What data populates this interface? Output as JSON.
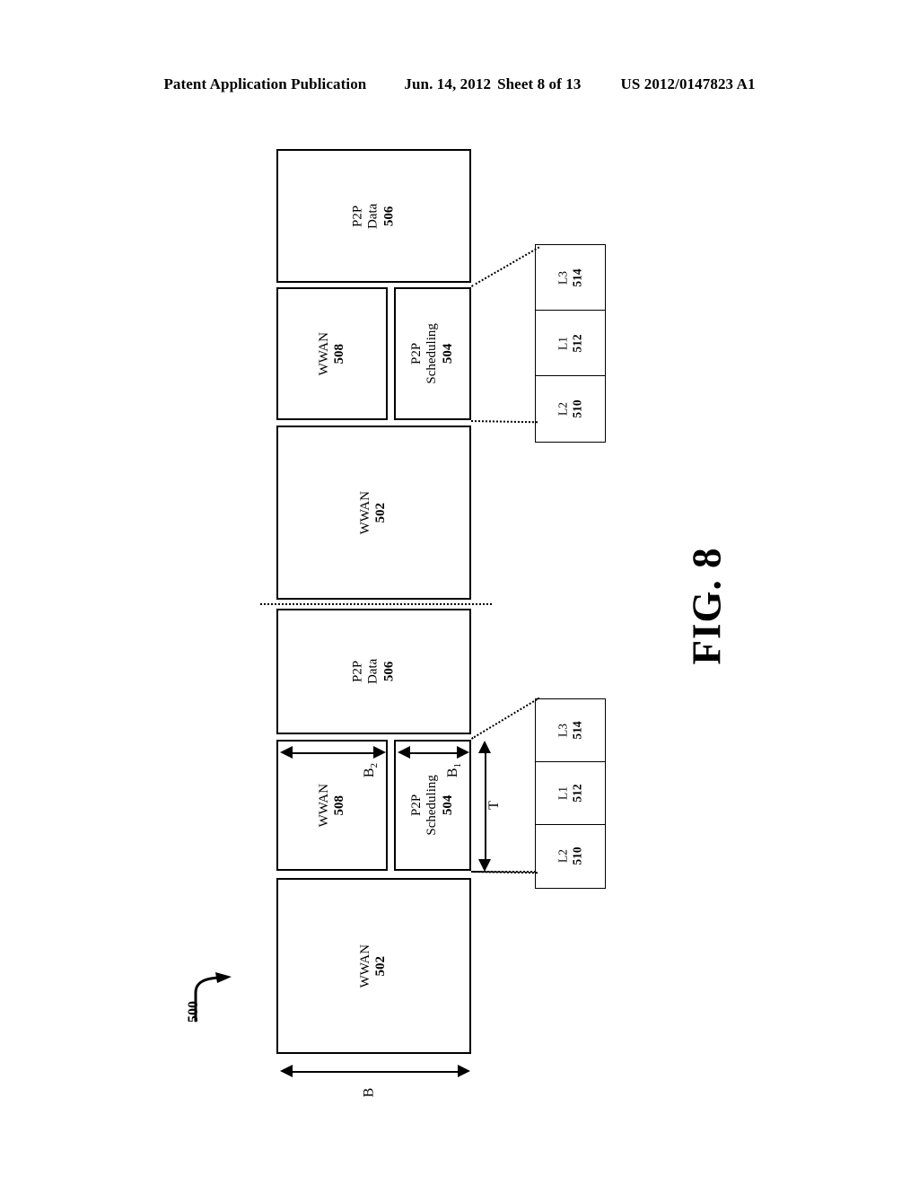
{
  "header": {
    "publication": "Patent Application Publication",
    "date": "Jun. 14, 2012",
    "sheet": "Sheet 8 of 13",
    "patent_number": "US 2012/0147823 A1"
  },
  "figure": {
    "caption": "FIG. 8",
    "reference_numeral": "500",
    "orientation": "rotated-90-ccw",
    "description": "Timeline of WWAN and P2P frame structure with expanded P2P scheduling sub-slots"
  },
  "blocks": {
    "wwan_502": {
      "name": "WWAN",
      "num": "502"
    },
    "wwan_508": {
      "name": "WWAN",
      "num": "508"
    },
    "p2p_scheduling_504": {
      "line1": "P2P",
      "line2": "Scheduling",
      "num": "504"
    },
    "p2p_data_506": {
      "line1": "P2P",
      "line2": "Data",
      "num": "506"
    },
    "l2_510": {
      "name": "L2",
      "num": "510"
    },
    "l1_512": {
      "name": "L1",
      "num": "512"
    },
    "l3_514": {
      "name": "L3",
      "num": "514"
    }
  },
  "dimensions": {
    "b": "B",
    "b1_base": "B",
    "b1_sub": "1",
    "b2_base": "B",
    "b2_sub": "2",
    "t": "T"
  },
  "colors": {
    "line": "#000000",
    "background": "#ffffff"
  },
  "frames": [
    {
      "id": "frame-lower",
      "sequence": 1,
      "segments": [
        "WWAN 502",
        "WWAN 508",
        "P2P Scheduling 504",
        "P2P Data 506"
      ],
      "expanded": [
        "L2 510",
        "L1 512",
        "L3 514"
      ],
      "annotated_dimensions": [
        "B",
        "B2",
        "B1",
        "T"
      ]
    },
    {
      "id": "frame-upper",
      "sequence": 2,
      "segments": [
        "WWAN 502",
        "WWAN 508",
        "P2P Scheduling 504",
        "P2P Data 506"
      ],
      "expanded": [
        "L2 510",
        "L1 512",
        "L3 514"
      ],
      "annotated_dimensions": []
    }
  ]
}
